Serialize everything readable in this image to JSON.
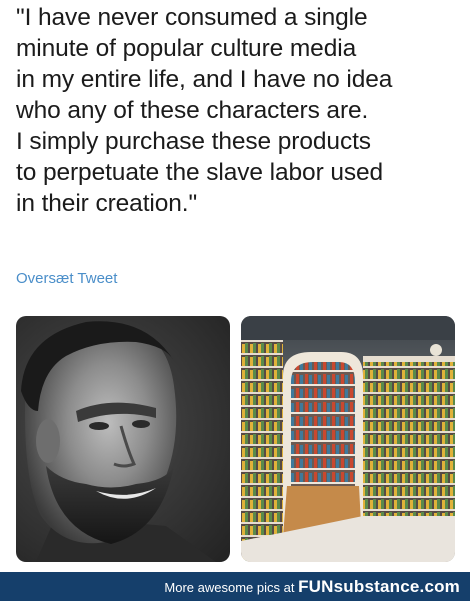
{
  "post": {
    "quote_lines": [
      "\"I have never consumed a single",
      "minute of popular culture media",
      "in my entire life, and I have no idea",
      "who any of these characters are.",
      "I simply purchase these products",
      "to perpetuate the slave labor used",
      "in their creation.\""
    ],
    "translate_link": "Oversæt Tweet"
  },
  "images": {
    "left": "gigachad-meme-face",
    "right": "room-full-of-collectible-figures"
  },
  "footer": {
    "text": "More awesome pics at",
    "brand": "FUNsubstance.com",
    "color": "#153f6b"
  }
}
